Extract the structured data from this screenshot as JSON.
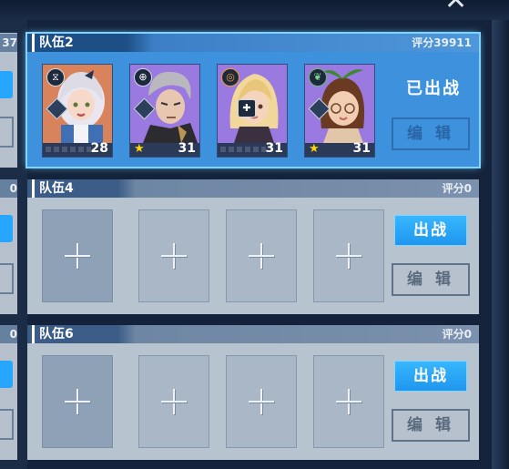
{
  "window": {
    "close_icon": "close-icon"
  },
  "left_column": {
    "score_top": "37",
    "score_mid": "0",
    "score_bot": "0"
  },
  "teams": [
    {
      "name": "队伍2",
      "score": "评分39911",
      "status": "已出战",
      "edit_label": "编 辑",
      "members": [
        {
          "level": "28",
          "bg": "#d8835c",
          "star": false,
          "class_icon": "hourglass-icon"
        },
        {
          "level": "31",
          "bg": "#9a7ae0",
          "star": true,
          "class_icon": "crosshair-icon"
        },
        {
          "level": "31",
          "bg": "#9a7ae0",
          "star": false,
          "class_icon": "search-icon"
        },
        {
          "level": "31",
          "bg": "#9a7ae0",
          "star": true,
          "class_icon": "leaf-icon"
        }
      ]
    },
    {
      "name": "队伍4",
      "score": "评分0",
      "battle_label": "出战",
      "edit_label": "编 辑"
    },
    {
      "name": "队伍6",
      "score": "评分0",
      "battle_label": "出战",
      "edit_label": "编 辑"
    }
  ],
  "colors": {
    "accent": "#27a6ff",
    "active_team": "#3d91dd",
    "star": "#ffd400"
  }
}
